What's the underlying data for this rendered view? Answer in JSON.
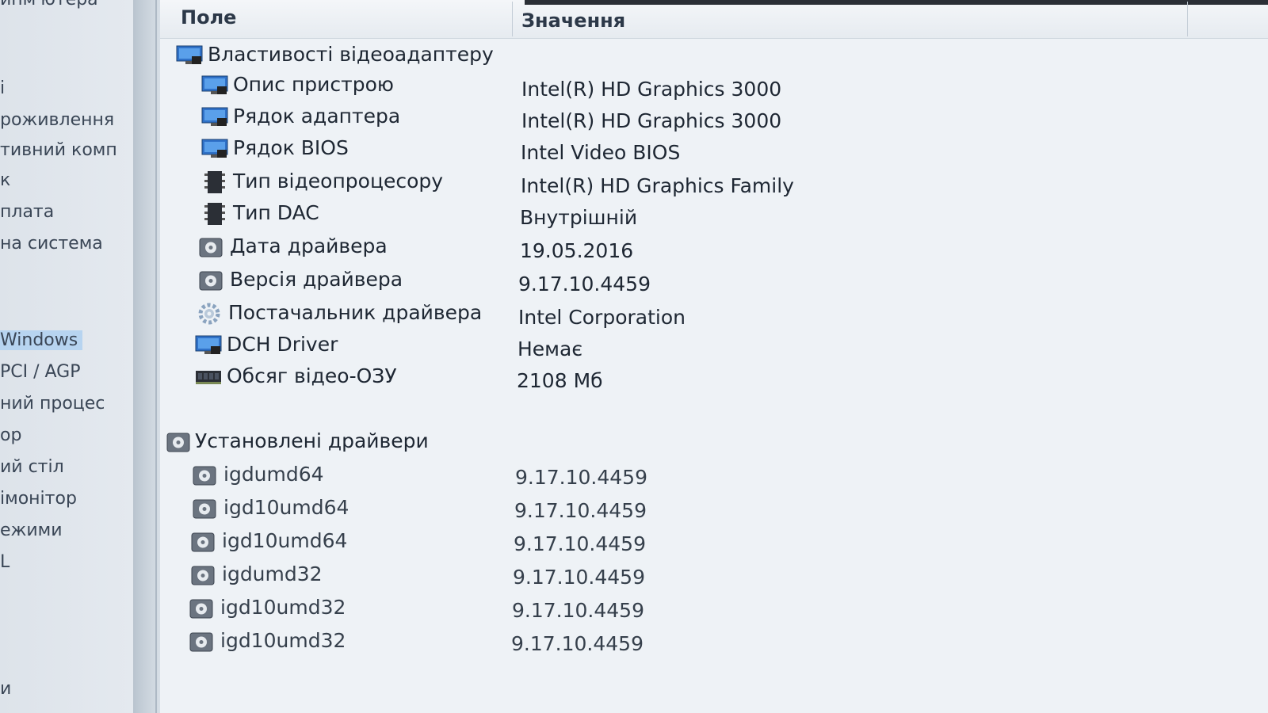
{
  "sidebar": {
    "items": [
      {
        "label": "ипм'ютера",
        "selected": false
      },
      {
        "label": "і",
        "selected": false
      },
      {
        "label": "роживлення",
        "selected": false
      },
      {
        "label": "тивний комп",
        "selected": false
      },
      {
        "label": "к",
        "selected": false
      },
      {
        "label": "плата",
        "selected": false
      },
      {
        "label": "на система",
        "selected": false
      },
      {
        "label": "Windows",
        "selected": true
      },
      {
        "label": "PCI / AGP",
        "selected": false
      },
      {
        "label": "ний процес",
        "selected": false
      },
      {
        "label": "ор",
        "selected": false
      },
      {
        "label": "ий стіл",
        "selected": false
      },
      {
        "label": "імонітор",
        "selected": false
      },
      {
        "label": "ежими",
        "selected": false
      },
      {
        "label": "L",
        "selected": false
      },
      {
        "label": "и",
        "selected": false
      }
    ]
  },
  "table": {
    "col_field": "Поле",
    "col_value": "Значення",
    "group1": {
      "label": "Властивості відеоадаптеру",
      "rows": [
        {
          "field": "Опис пристрою",
          "value": "Intel(R) HD Graphics 3000",
          "icon": "monitor-icon"
        },
        {
          "field": "Рядок адаптера",
          "value": "Intel(R) HD Graphics 3000",
          "icon": "monitor-icon"
        },
        {
          "field": "Рядок BIOS",
          "value": "Intel Video BIOS",
          "icon": "monitor-icon"
        },
        {
          "field": "Тип відеопроцесору",
          "value": "Intel(R) HD Graphics Family",
          "icon": "chip-icon"
        },
        {
          "field": "Тип DAC",
          "value": "Внутрішній",
          "icon": "chip-icon"
        },
        {
          "field": "Дата драйвера",
          "value": "19.05.2016",
          "icon": "driver-disc-icon"
        },
        {
          "field": "Версія драйвера",
          "value": "9.17.10.4459",
          "icon": "driver-disc-icon"
        },
        {
          "field": "Постачальник драйвера",
          "value": "Intel Corporation",
          "icon": "gear-icon"
        },
        {
          "field": "DCH Driver",
          "value": "Немає",
          "icon": "monitor-icon"
        },
        {
          "field": "Обсяг відео-ОЗУ",
          "value": "2108 Мб",
          "icon": "memory-icon"
        }
      ]
    },
    "group2": {
      "label": "Установлені драйвери",
      "rows": [
        {
          "field": "igdumd64",
          "value": "9.17.10.4459"
        },
        {
          "field": "igd10umd64",
          "value": "9.17.10.4459"
        },
        {
          "field": "igd10umd64",
          "value": "9.17.10.4459"
        },
        {
          "field": "igdumd32",
          "value": "9.17.10.4459"
        },
        {
          "field": "igd10umd32",
          "value": "9.17.10.4459"
        },
        {
          "field": "igd10umd32",
          "value": "9.17.10.4459"
        }
      ]
    }
  }
}
